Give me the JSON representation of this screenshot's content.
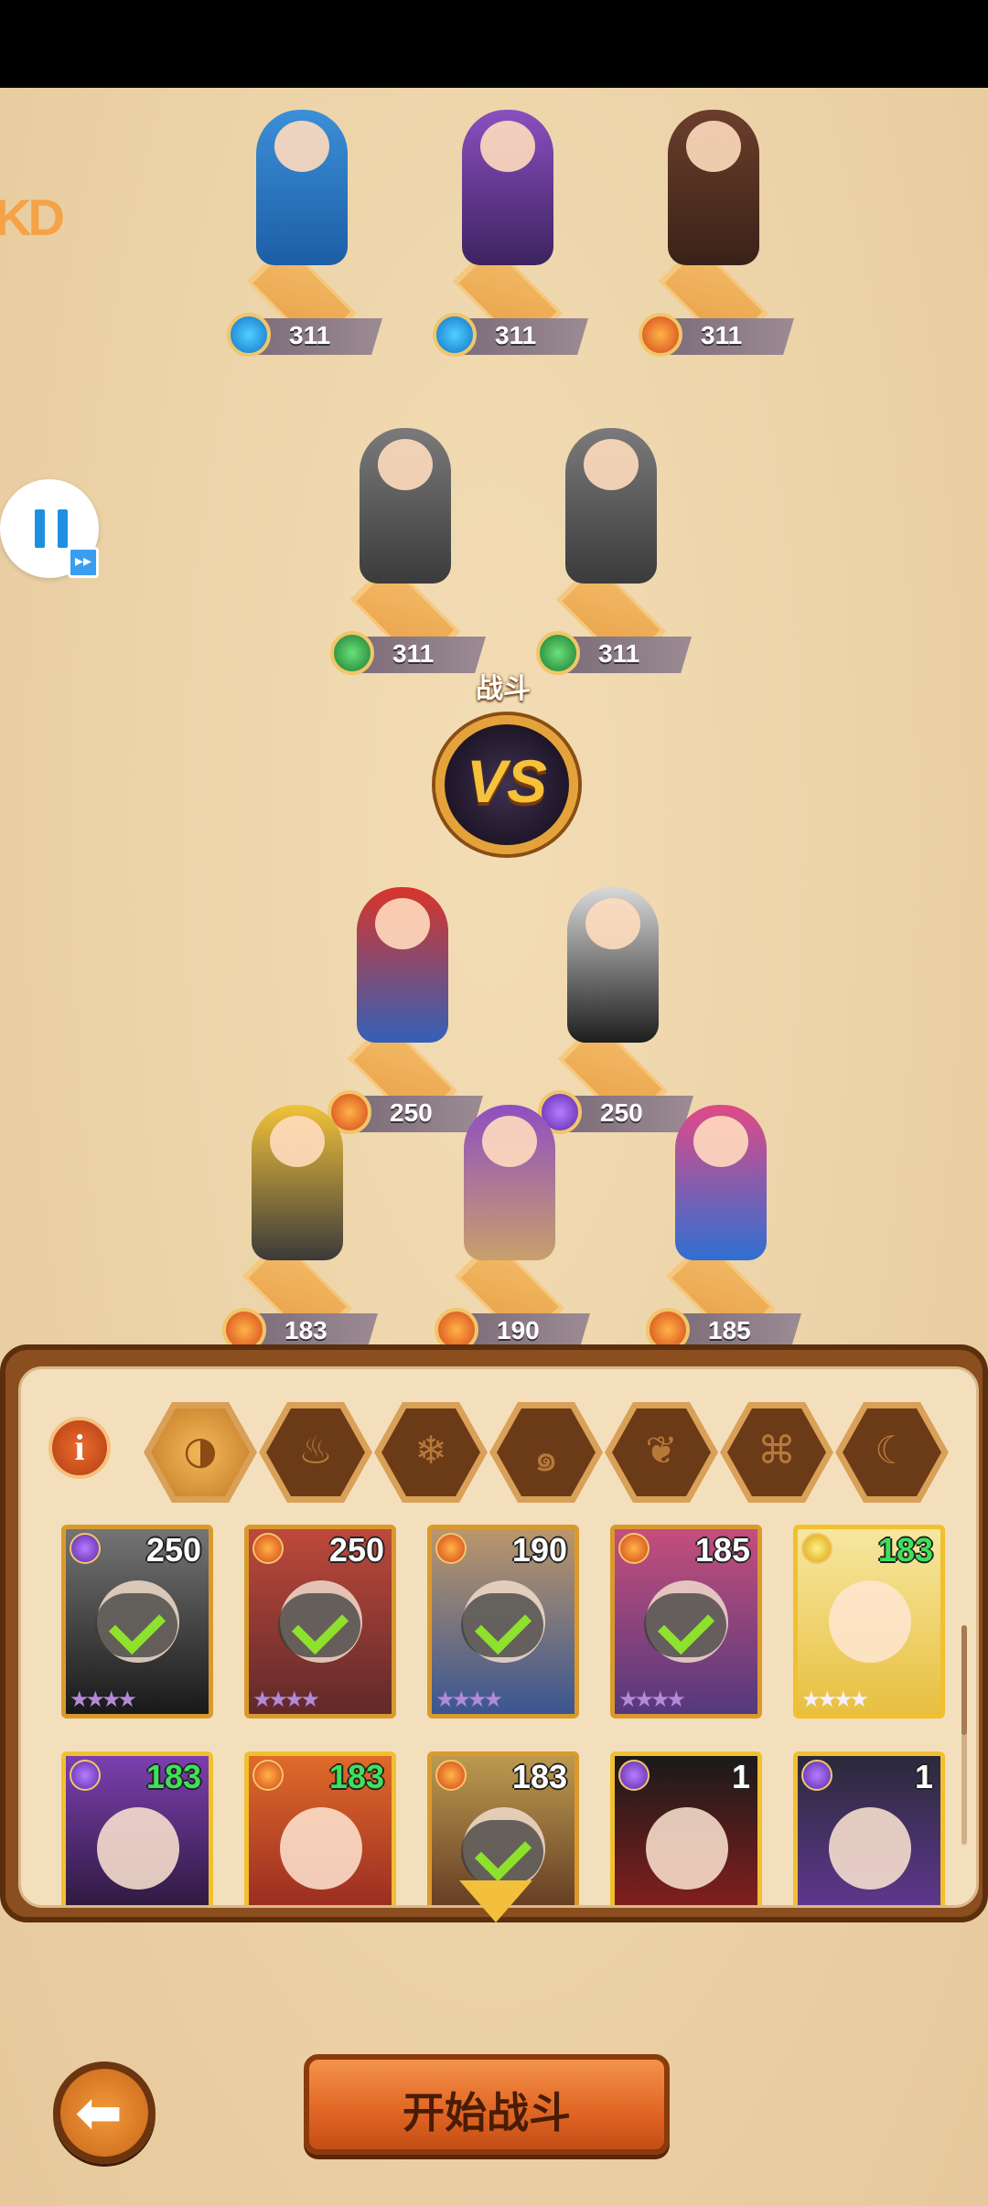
{
  "hud": {
    "pause_icon": "pause-icon",
    "fast_forward_icon": "fast-forward-icon",
    "fast_forward_glyph": "▸▸"
  },
  "enemy_team": [
    {
      "level": "311",
      "element": "water"
    },
    {
      "level": "311",
      "element": "water"
    },
    {
      "level": "311",
      "element": "fire"
    },
    {
      "level": "311",
      "element": "earth"
    },
    {
      "level": "311",
      "element": "earth"
    }
  ],
  "battle_label": "战斗",
  "vs_text": "VS",
  "player_team": [
    {
      "level": "250",
      "element": "fire"
    },
    {
      "level": "250",
      "element": "dark"
    },
    {
      "level": "183",
      "element": "fire"
    },
    {
      "level": "190",
      "element": "fire"
    },
    {
      "level": "185",
      "element": "fire"
    }
  ],
  "filters": [
    {
      "name": "all",
      "glyph": "◑",
      "active": true
    },
    {
      "name": "fire",
      "glyph": "♨",
      "active": false
    },
    {
      "name": "ice",
      "glyph": "❄",
      "active": false
    },
    {
      "name": "wind",
      "glyph": "๑",
      "active": false
    },
    {
      "name": "nature",
      "glyph": "❦",
      "active": false
    },
    {
      "name": "light",
      "glyph": "⌘",
      "active": false
    },
    {
      "name": "dark",
      "glyph": "☾",
      "active": false
    }
  ],
  "info_label": "i",
  "hero_cards": [
    {
      "level": "250",
      "selected": true,
      "level_color": "white",
      "element": "dark"
    },
    {
      "level": "250",
      "selected": true,
      "level_color": "white",
      "element": "fire"
    },
    {
      "level": "190",
      "selected": true,
      "level_color": "white",
      "element": "fire"
    },
    {
      "level": "185",
      "selected": true,
      "level_color": "white",
      "element": "fire"
    },
    {
      "level": "183",
      "selected": false,
      "level_color": "green",
      "element": "light"
    },
    {
      "level": "183",
      "selected": false,
      "level_color": "green",
      "element": "dark"
    },
    {
      "level": "183",
      "selected": false,
      "level_color": "green",
      "element": "fire"
    },
    {
      "level": "183",
      "selected": true,
      "level_color": "white",
      "element": "fire"
    },
    {
      "level": "1",
      "selected": false,
      "level_color": "white",
      "element": "dark"
    },
    {
      "level": "1",
      "selected": false,
      "level_color": "white",
      "element": "dark"
    }
  ],
  "stars": "★★★★",
  "back_glyph": "⬅",
  "start_button_label": "开始战斗",
  "colors": {
    "background": "#ecd3a8",
    "panel_frame": "#8b4e1f",
    "start_button": "#e26826",
    "level_green": "#3ee15a",
    "check_green": "#8ee12c"
  }
}
